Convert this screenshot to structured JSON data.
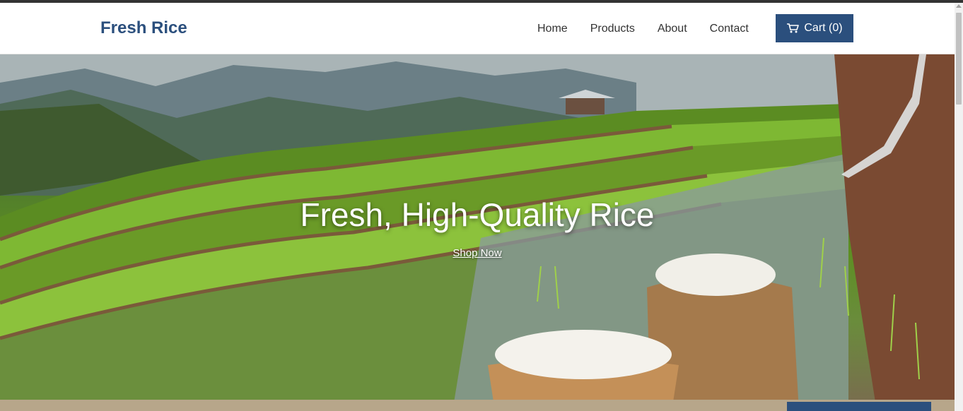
{
  "brand": {
    "name": "Fresh Rice"
  },
  "nav": {
    "items": [
      {
        "label": "Home"
      },
      {
        "label": "Products"
      },
      {
        "label": "About"
      },
      {
        "label": "Contact"
      }
    ]
  },
  "cart": {
    "label": "Cart (0)",
    "icon": "shopping-cart-icon"
  },
  "hero": {
    "title": "Fresh, High-Quality Rice",
    "cta": "Shop Now"
  },
  "colors": {
    "brand": "#2b4f7d",
    "nav_text": "#333333",
    "hero_text": "#ffffff"
  }
}
